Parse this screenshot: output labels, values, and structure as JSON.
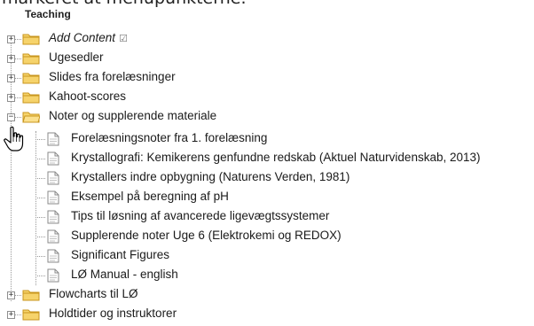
{
  "intro_text": "markeret at menupunkterne.",
  "tree": {
    "root_label": "Teaching",
    "items": [
      {
        "label": "Add Content",
        "italic": true,
        "edit_mark": "☑",
        "expanded": false
      },
      {
        "label": "Ugesedler",
        "expanded": false
      },
      {
        "label": "Slides fra forelæsninger",
        "expanded": false
      },
      {
        "label": "Kahoot-scores",
        "expanded": false
      },
      {
        "label": "Noter og supplerende materiale",
        "expanded": true,
        "children": [
          {
            "label": "Forelæsningsnoter fra 1. forelæsning"
          },
          {
            "label": "Krystallografi: Kemikerens genfundne redskab (Aktuel Naturvidenskab, 2013)"
          },
          {
            "label": "Krystallers indre opbygning (Naturens Verden, 1981)"
          },
          {
            "label": "Eksempel på beregning af pH"
          },
          {
            "label": "Tips til løsning af avancerede ligevægtssystemer"
          },
          {
            "label": "Supplerende noter Uge 6 (Elektrokemi og REDOX)"
          },
          {
            "label": "Significant Figures"
          },
          {
            "label": "LØ Manual - english"
          }
        ]
      },
      {
        "label": "Flowcharts til LØ",
        "expanded": false
      },
      {
        "label": "Holdtider og instruktorer",
        "expanded": false
      }
    ]
  },
  "icons": {
    "folder": "folder-icon",
    "document": "document-icon",
    "expand": "expand-toggle-icon",
    "collapse": "collapse-toggle-icon",
    "cursor": "hand-pointer-cursor-icon"
  },
  "colors": {
    "folder_fill": "#f6d36b",
    "folder_stroke": "#c8961e",
    "line": "#9a9a9a"
  }
}
